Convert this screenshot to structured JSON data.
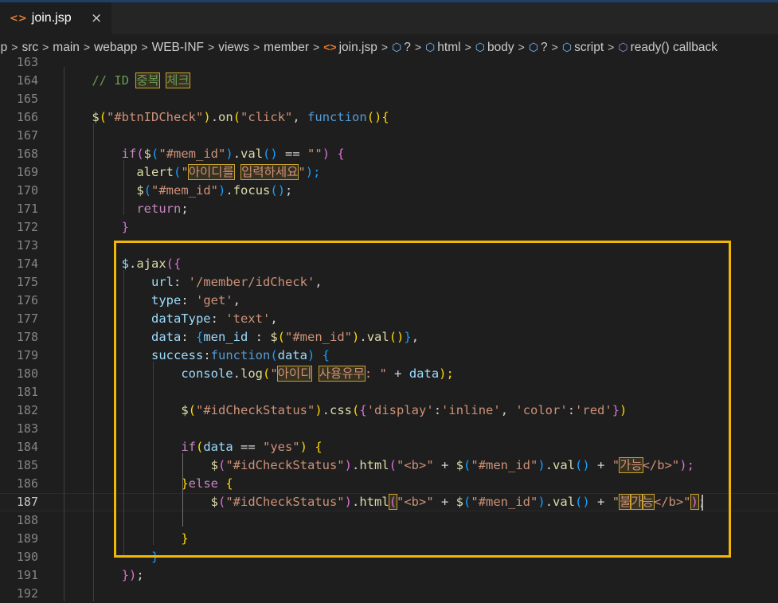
{
  "tab": {
    "icon": "jsp-file-icon",
    "label": "join.jsp",
    "close": "×"
  },
  "breadcrumb": [
    {
      "text": "op",
      "icon": null
    },
    {
      "text": "src",
      "icon": null
    },
    {
      "text": "main",
      "icon": null
    },
    {
      "text": "webapp",
      "icon": null
    },
    {
      "text": "WEB-INF",
      "icon": null
    },
    {
      "text": "views",
      "icon": null
    },
    {
      "text": "member",
      "icon": null
    },
    {
      "text": "join.jsp",
      "icon": "jsp"
    },
    {
      "text": "?",
      "icon": "cube"
    },
    {
      "text": "html",
      "icon": "cube"
    },
    {
      "text": "body",
      "icon": "cube"
    },
    {
      "text": "?",
      "icon": "cube"
    },
    {
      "text": "script",
      "icon": "cube"
    },
    {
      "text": "ready() callback",
      "icon": "cube-purple"
    }
  ],
  "separator": ">",
  "current_line": "187",
  "lines": [
    {
      "n": "163",
      "tokens": []
    },
    {
      "n": "164",
      "tokens": [
        [
          "    ",
          "t"
        ],
        [
          "// ID ",
          "c"
        ],
        [
          "중복",
          "c hl"
        ],
        [
          " ",
          "c"
        ],
        [
          "체크",
          "c hl"
        ]
      ]
    },
    {
      "n": "165",
      "tokens": []
    },
    {
      "n": "166",
      "tokens": [
        [
          "    ",
          "t"
        ],
        [
          "$",
          "f"
        ],
        [
          "(",
          "p1"
        ],
        [
          "\"#btnIDCheck\"",
          "s"
        ],
        [
          ")",
          "p1"
        ],
        [
          ".",
          "t"
        ],
        [
          "on",
          "f"
        ],
        [
          "(",
          "p1"
        ],
        [
          "\"click\"",
          "s"
        ],
        [
          ", ",
          "t"
        ],
        [
          "function",
          "k"
        ],
        [
          "(){",
          "p1"
        ]
      ]
    },
    {
      "n": "167",
      "tokens": []
    },
    {
      "n": "168",
      "tokens": [
        [
          "        ",
          "t"
        ],
        [
          "if",
          "kw"
        ],
        [
          "(",
          "p2"
        ],
        [
          "$",
          "f"
        ],
        [
          "(",
          "p3"
        ],
        [
          "\"#mem_id\"",
          "s"
        ],
        [
          ")",
          "p3"
        ],
        [
          ".",
          "t"
        ],
        [
          "val",
          "f"
        ],
        [
          "()",
          "p3"
        ],
        [
          " == ",
          "t"
        ],
        [
          "\"\"",
          "s"
        ],
        [
          ") {",
          "p2"
        ]
      ]
    },
    {
      "n": "169",
      "tokens": [
        [
          "          ",
          "t"
        ],
        [
          "alert",
          "f"
        ],
        [
          "(",
          "p3"
        ],
        [
          "\"",
          "s"
        ],
        [
          "아이디를",
          "s hl"
        ],
        [
          " ",
          "s"
        ],
        [
          "입력하세요",
          "s hl"
        ],
        [
          "\"",
          "s"
        ],
        [
          ");",
          "p3"
        ]
      ]
    },
    {
      "n": "170",
      "tokens": [
        [
          "          ",
          "t"
        ],
        [
          "$",
          "f"
        ],
        [
          "(",
          "p3"
        ],
        [
          "\"#mem_id\"",
          "s"
        ],
        [
          ")",
          "p3"
        ],
        [
          ".",
          "t"
        ],
        [
          "focus",
          "f"
        ],
        [
          "()",
          "p3"
        ],
        [
          ";",
          "t"
        ]
      ]
    },
    {
      "n": "171",
      "tokens": [
        [
          "          ",
          "t"
        ],
        [
          "return",
          "kw"
        ],
        [
          ";",
          "t"
        ]
      ]
    },
    {
      "n": "172",
      "tokens": [
        [
          "        ",
          "t"
        ],
        [
          "}",
          "p2"
        ]
      ]
    },
    {
      "n": "173",
      "tokens": []
    },
    {
      "n": "174",
      "tokens": [
        [
          "        ",
          "t"
        ],
        [
          "$",
          "v"
        ],
        [
          ".",
          "t"
        ],
        [
          "ajax",
          "f"
        ],
        [
          "({",
          "p2"
        ]
      ]
    },
    {
      "n": "175",
      "tokens": [
        [
          "            ",
          "t"
        ],
        [
          "url",
          "v"
        ],
        [
          ": ",
          "t"
        ],
        [
          "'/member/idCheck'",
          "s"
        ],
        [
          ",",
          "t"
        ]
      ]
    },
    {
      "n": "176",
      "tokens": [
        [
          "            ",
          "t"
        ],
        [
          "type",
          "v"
        ],
        [
          ": ",
          "t"
        ],
        [
          "'get'",
          "s"
        ],
        [
          ",",
          "t"
        ]
      ]
    },
    {
      "n": "177",
      "tokens": [
        [
          "            ",
          "t"
        ],
        [
          "dataType",
          "v"
        ],
        [
          ": ",
          "t"
        ],
        [
          "'text'",
          "s"
        ],
        [
          ",",
          "t"
        ]
      ]
    },
    {
      "n": "178",
      "tokens": [
        [
          "            ",
          "t"
        ],
        [
          "data",
          "v"
        ],
        [
          ": ",
          "t"
        ],
        [
          "{",
          "p3"
        ],
        [
          "men_id",
          "v"
        ],
        [
          " : ",
          "t"
        ],
        [
          "$",
          "f"
        ],
        [
          "(",
          "p1"
        ],
        [
          "\"#men_id\"",
          "s"
        ],
        [
          ")",
          "p1"
        ],
        [
          ".",
          "t"
        ],
        [
          "val",
          "f"
        ],
        [
          "()",
          "p1"
        ],
        [
          "}",
          "p3"
        ],
        [
          ",",
          "t"
        ]
      ]
    },
    {
      "n": "179",
      "tokens": [
        [
          "            ",
          "t"
        ],
        [
          "success",
          "v"
        ],
        [
          ":",
          "t"
        ],
        [
          "function",
          "k"
        ],
        [
          "(",
          "p3"
        ],
        [
          "data",
          "v"
        ],
        [
          ") {",
          "p3"
        ]
      ]
    },
    {
      "n": "180",
      "tokens": [
        [
          "                ",
          "t"
        ],
        [
          "console",
          "v"
        ],
        [
          ".",
          "t"
        ],
        [
          "log",
          "f"
        ],
        [
          "(",
          "p1"
        ],
        [
          "\"",
          "s"
        ],
        [
          "아이디",
          "s hl"
        ],
        [
          " ",
          "s"
        ],
        [
          "사용유무",
          "s hl"
        ],
        [
          ": \"",
          "s"
        ],
        [
          " + ",
          "t"
        ],
        [
          "data",
          "v"
        ],
        [
          ");",
          "p1"
        ]
      ]
    },
    {
      "n": "181",
      "tokens": []
    },
    {
      "n": "182",
      "tokens": [
        [
          "                ",
          "t"
        ],
        [
          "$",
          "f"
        ],
        [
          "(",
          "p1"
        ],
        [
          "\"#idCheckStatus\"",
          "s"
        ],
        [
          ")",
          "p1"
        ],
        [
          ".",
          "t"
        ],
        [
          "css",
          "f"
        ],
        [
          "(",
          "p1"
        ],
        [
          "{",
          "p2"
        ],
        [
          "'display'",
          "s"
        ],
        [
          ":",
          "t"
        ],
        [
          "'inline'",
          "s"
        ],
        [
          ", ",
          "t"
        ],
        [
          "'color'",
          "s"
        ],
        [
          ":",
          "t"
        ],
        [
          "'red'",
          "s"
        ],
        [
          "}",
          "p2"
        ],
        [
          ")",
          "p1"
        ]
      ]
    },
    {
      "n": "183",
      "tokens": []
    },
    {
      "n": "184",
      "tokens": [
        [
          "                ",
          "t"
        ],
        [
          "if",
          "kw"
        ],
        [
          "(",
          "p1"
        ],
        [
          "data",
          "v"
        ],
        [
          " == ",
          "t"
        ],
        [
          "\"yes\"",
          "s"
        ],
        [
          ") {",
          "p1"
        ]
      ]
    },
    {
      "n": "185",
      "tokens": [
        [
          "                    ",
          "t"
        ],
        [
          "$",
          "f"
        ],
        [
          "(",
          "p2"
        ],
        [
          "\"#idCheckStatus\"",
          "s"
        ],
        [
          ")",
          "p2"
        ],
        [
          ".",
          "t"
        ],
        [
          "html",
          "f"
        ],
        [
          "(",
          "p2"
        ],
        [
          "\"<b>\"",
          "s"
        ],
        [
          " + ",
          "t"
        ],
        [
          "$",
          "f"
        ],
        [
          "(",
          "p3"
        ],
        [
          "\"#men_id\"",
          "s"
        ],
        [
          ")",
          "p3"
        ],
        [
          ".",
          "t"
        ],
        [
          "val",
          "f"
        ],
        [
          "()",
          "p3"
        ],
        [
          " + ",
          "t"
        ],
        [
          "\"",
          "s"
        ],
        [
          "가능",
          "s hl"
        ],
        [
          "</b>\"",
          "s"
        ],
        [
          ");",
          "p2"
        ]
      ]
    },
    {
      "n": "186",
      "tokens": [
        [
          "                ",
          "t"
        ],
        [
          "}",
          "p1"
        ],
        [
          "else",
          "kw"
        ],
        [
          " {",
          "p1"
        ]
      ]
    },
    {
      "n": "187",
      "tokens": [
        [
          "                    ",
          "t"
        ],
        [
          "$",
          "f"
        ],
        [
          "(",
          "p2"
        ],
        [
          "\"#idCheckStatus\"",
          "s"
        ],
        [
          ")",
          "p2"
        ],
        [
          ".",
          "t"
        ],
        [
          "html",
          "f"
        ],
        [
          "(",
          "p2 hl"
        ],
        [
          "\"<b>\"",
          "s"
        ],
        [
          " + ",
          "t"
        ],
        [
          "$",
          "f"
        ],
        [
          "(",
          "p3"
        ],
        [
          "\"#men_id\"",
          "s"
        ],
        [
          ")",
          "p3"
        ],
        [
          ".",
          "t"
        ],
        [
          "val",
          "f"
        ],
        [
          "()",
          "p3"
        ],
        [
          " + ",
          "t"
        ],
        [
          "\"",
          "s"
        ],
        [
          "불",
          "s hl"
        ],
        [
          "가",
          "s hl"
        ],
        [
          "능",
          "s hl"
        ],
        [
          "</b>\"",
          "s"
        ],
        [
          ")",
          "p2 hl"
        ],
        [
          ";",
          "t"
        ]
      ]
    },
    {
      "n": "188",
      "tokens": []
    },
    {
      "n": "189",
      "tokens": [
        [
          "                ",
          "t"
        ],
        [
          "}",
          "p1"
        ]
      ]
    },
    {
      "n": "190",
      "tokens": [
        [
          "            ",
          "t"
        ],
        [
          "}",
          "p3"
        ]
      ]
    },
    {
      "n": "191",
      "tokens": [
        [
          "        ",
          "t"
        ],
        [
          "})",
          "p2"
        ],
        [
          ";",
          "t"
        ]
      ]
    },
    {
      "n": "192",
      "tokens": []
    }
  ]
}
